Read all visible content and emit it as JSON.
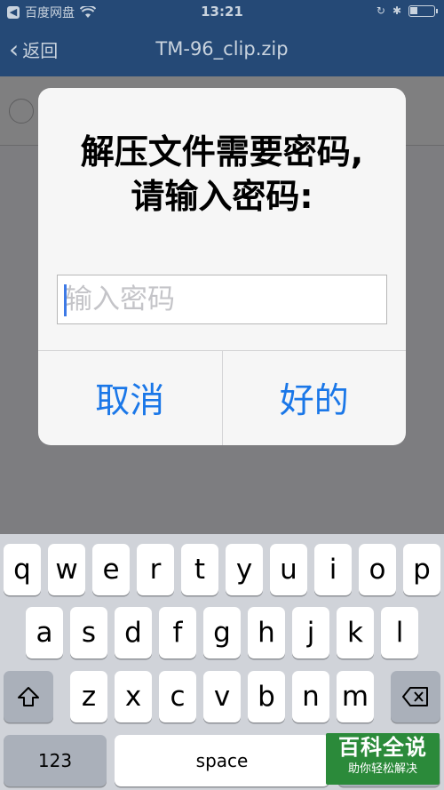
{
  "status_bar": {
    "carrier": "百度网盘",
    "time": "13:21"
  },
  "nav": {
    "back_label": "返回",
    "title": "TM-96_clip.zip"
  },
  "alert": {
    "message_line1": "解压文件需要密码,",
    "message_line2": "请输入密码:",
    "password_placeholder": "输入密码",
    "password_value": "",
    "cancel_label": "取消",
    "ok_label": "好的",
    "accent_color": "#1a77e8"
  },
  "keyboard": {
    "row1": [
      "q",
      "w",
      "e",
      "r",
      "t",
      "y",
      "u",
      "i",
      "o",
      "p"
    ],
    "row2": [
      "a",
      "s",
      "d",
      "f",
      "g",
      "h",
      "j",
      "k",
      "l"
    ],
    "row3": [
      "z",
      "x",
      "c",
      "v",
      "b",
      "n",
      "m"
    ],
    "numbers_label": "123",
    "space_label": "space"
  },
  "watermark": {
    "title": "百科全说",
    "subtitle": "助你轻松解决"
  }
}
